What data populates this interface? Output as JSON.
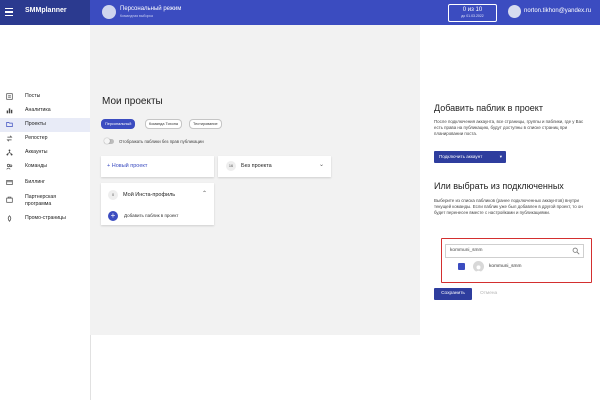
{
  "app": {
    "brand": "SMMplanner"
  },
  "header": {
    "mode_title": "Персональный режим",
    "mode_subtitle": "Командная выборка",
    "counter_main": "0 из 10",
    "counter_sub": "до 01.03.2022",
    "user_email": "norton.tikhon@yandex.ru"
  },
  "sidebar": {
    "items": [
      {
        "label": "Посты",
        "icon": "posts-icon"
      },
      {
        "label": "Аналитика",
        "icon": "analytics-icon"
      },
      {
        "label": "Проекты",
        "icon": "folder-icon",
        "active": true
      },
      {
        "label": "Репостер",
        "icon": "reposter-icon"
      },
      {
        "label": "Аккаунты",
        "icon": "accounts-icon"
      },
      {
        "label": "Команды",
        "icon": "teams-icon"
      },
      {
        "label": "Биллинг",
        "icon": "billing-icon"
      },
      {
        "label": "Партнерская программа",
        "icon": "partner-icon"
      },
      {
        "label": "Промо-страницы",
        "icon": "promo-icon"
      }
    ]
  },
  "main": {
    "title": "Мои проекты",
    "tabs": [
      {
        "label": "Персональный",
        "active": true
      },
      {
        "label": "Команда Тихона",
        "active": false
      },
      {
        "label": "Тестирование",
        "active": false
      }
    ],
    "toggle_label": "Отображать паблики без прав публикации",
    "new_project_label": "+ Новый проект",
    "no_project": {
      "count": "16",
      "label": "Без проекта"
    },
    "insta_project": {
      "count": "0",
      "title": "Мой Инста-профиль",
      "add_label": "Добавить паблик в проект"
    }
  },
  "panel": {
    "add_title": "Добавить паблик в проект",
    "add_text": "После подключения аккаунта, все страницы, группы и паблики, где у Вас есть права на публикацию, будут доступны в списке страниц при планировании поста.",
    "connect_button": "Подключить аккаунт",
    "choose_title": "Или выбрать из подключенных",
    "choose_text": "Выберите из списка пабликов (ранее подключенных аккаунтов) внутри текущей команды. Если паблик уже был добавлен в другой проект, то он будет перенесен вместе с настройками и публикациями.",
    "search_value": "kommuni_smm",
    "item_label": "kommuni_smm",
    "item_checked": true,
    "save_button": "Сохранить",
    "cancel_link": "Отмена"
  },
  "colors": {
    "accent": "#3b4cc0",
    "accent_dark": "#2b3a8f",
    "highlight": "#d32f2f"
  }
}
